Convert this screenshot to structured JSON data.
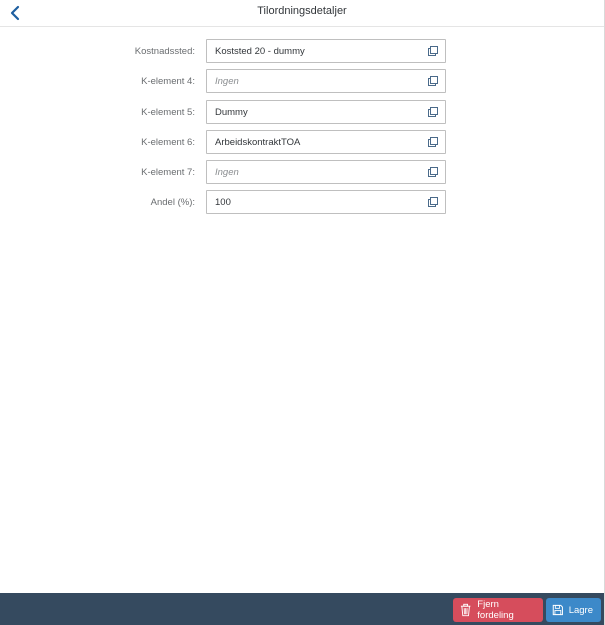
{
  "header": {
    "title": "Tilordningsdetaljer",
    "back_icon": "chevron-left-icon"
  },
  "form": {
    "rows": [
      {
        "label": "Kostnadssted:",
        "value": "Koststed 20 - dummy",
        "placeholder": ""
      },
      {
        "label": "K-element 4:",
        "value": "",
        "placeholder": "Ingen"
      },
      {
        "label": "K-element 5:",
        "value": "Dummy",
        "placeholder": ""
      },
      {
        "label": "K-element 6:",
        "value": "ArbeidskontraktTOA",
        "placeholder": ""
      },
      {
        "label": "K-element 7:",
        "value": "",
        "placeholder": "Ingen"
      },
      {
        "label": "Andel (%):",
        "value": "100",
        "placeholder": ""
      }
    ],
    "field_icon": "copy-icon"
  },
  "footer": {
    "delete_label": "Fjern fordeling",
    "delete_icon": "trash-icon",
    "save_label": "Lagre",
    "save_icon": "save-icon"
  },
  "colors": {
    "footer_bg": "#354a5f",
    "delete_button": "#d64d5c",
    "save_button": "#3c89c9",
    "back_chevron": "#0a6ed1"
  }
}
